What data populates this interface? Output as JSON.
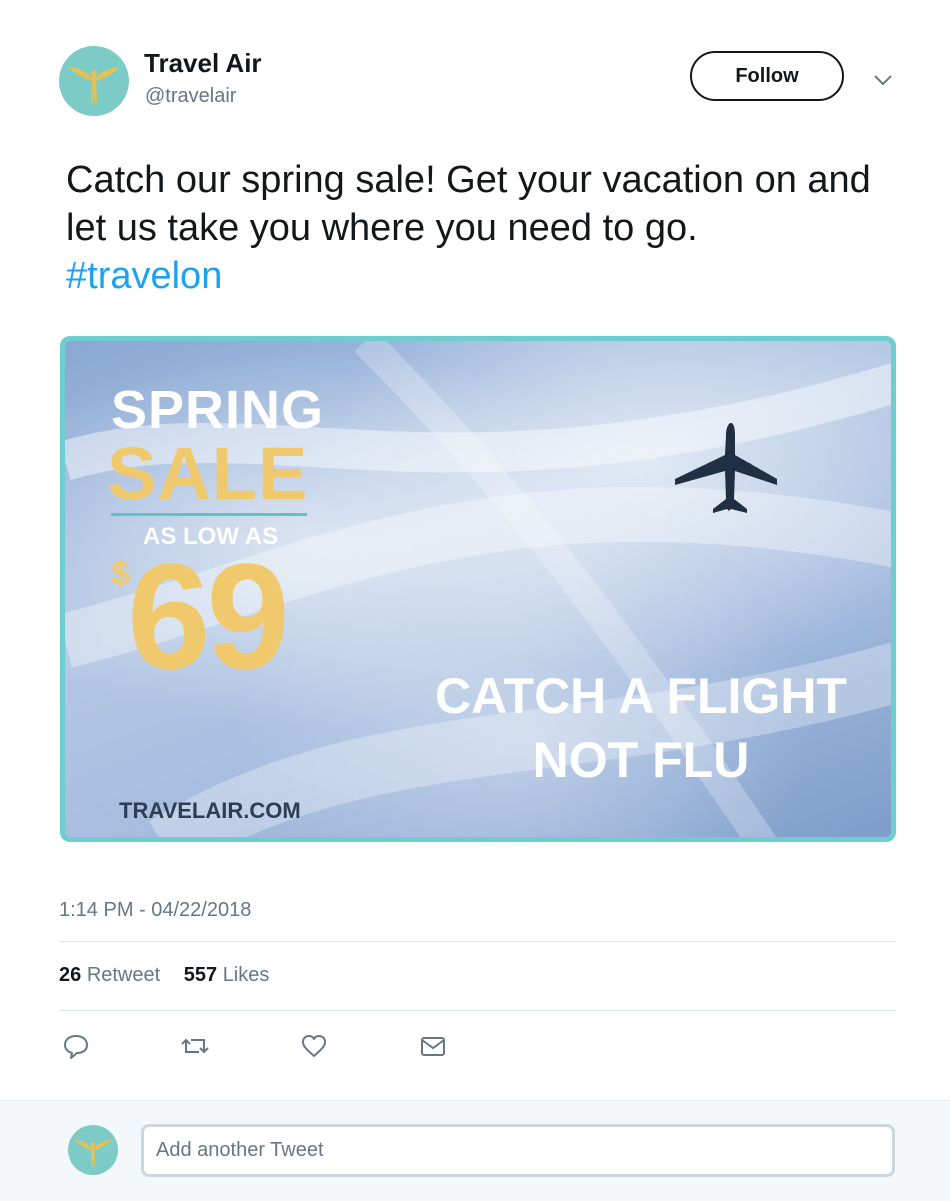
{
  "author": {
    "name": "Travel Air",
    "handle": "@travelair",
    "avatar_icon": "winged-figure-logo-icon"
  },
  "header": {
    "follow_label": "Follow",
    "menu_icon": "chevron-down-icon"
  },
  "tweet": {
    "text": "Catch our spring sale! Get your vacation on and let us take you where you need to go.",
    "hashtag": "#travelon"
  },
  "promo": {
    "line1": "SPRING",
    "line2": "SALE",
    "subline": "AS LOW AS",
    "currency": "$",
    "price": "69",
    "tagline1": "CATCH A FLIGHT",
    "tagline2": "NOT FLU",
    "website": "TRAVELAIR.COM",
    "image_icon": "airplane-icon"
  },
  "meta": {
    "timestamp": "1:14 PM -  04/22/2018",
    "retweet_count": "26",
    "retweet_label": "Retweet",
    "likes_count": "557",
    "likes_label": "Likes"
  },
  "actions": [
    {
      "icon": "reply-icon"
    },
    {
      "icon": "retweet-icon"
    },
    {
      "icon": "like-icon"
    },
    {
      "icon": "direct-message-icon"
    }
  ],
  "reply": {
    "placeholder": "Add another Tweet"
  },
  "colors": {
    "accent": "#1da1f2",
    "card_border": "#6dcdcf",
    "promo_yellow": "#f0c96d",
    "avatar_bg": "#7ccbc7"
  }
}
